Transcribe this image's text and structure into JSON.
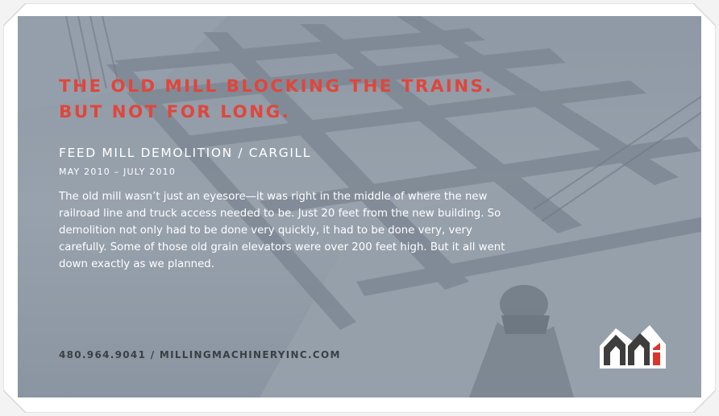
{
  "headline": {
    "line1": "THE OLD MILL BLOCKING THE TRAINS.",
    "line2": "BUT NOT FOR LONG."
  },
  "project": {
    "title": "FEED MILL DEMOLITION / CARGILL",
    "dates": "MAY 2010 – JULY 2010",
    "description": "The old mill wasn’t just an eyesore—it was right in the middle of where the new railroad line and truck access needed to be. Just 20 feet from the new building. So demolition not only had to be done very quickly, it had to be done very, very carefully. Some of those old grain elevators were over 200 feet high. But it all went down exactly as we planned."
  },
  "contact": {
    "line": "480.964.9041 / MILLINGMACHINERYINC.COM"
  },
  "logo": {
    "name": "mm-logo",
    "colors": {
      "frame": "#ffffff",
      "letters": "#3d3d3d",
      "accent": "#d9362b"
    }
  },
  "colors": {
    "headline": "#e0463c",
    "photo_tint": "#8f9aa6",
    "page_border": "#ffffff",
    "contact_text": "#3b3f44"
  }
}
